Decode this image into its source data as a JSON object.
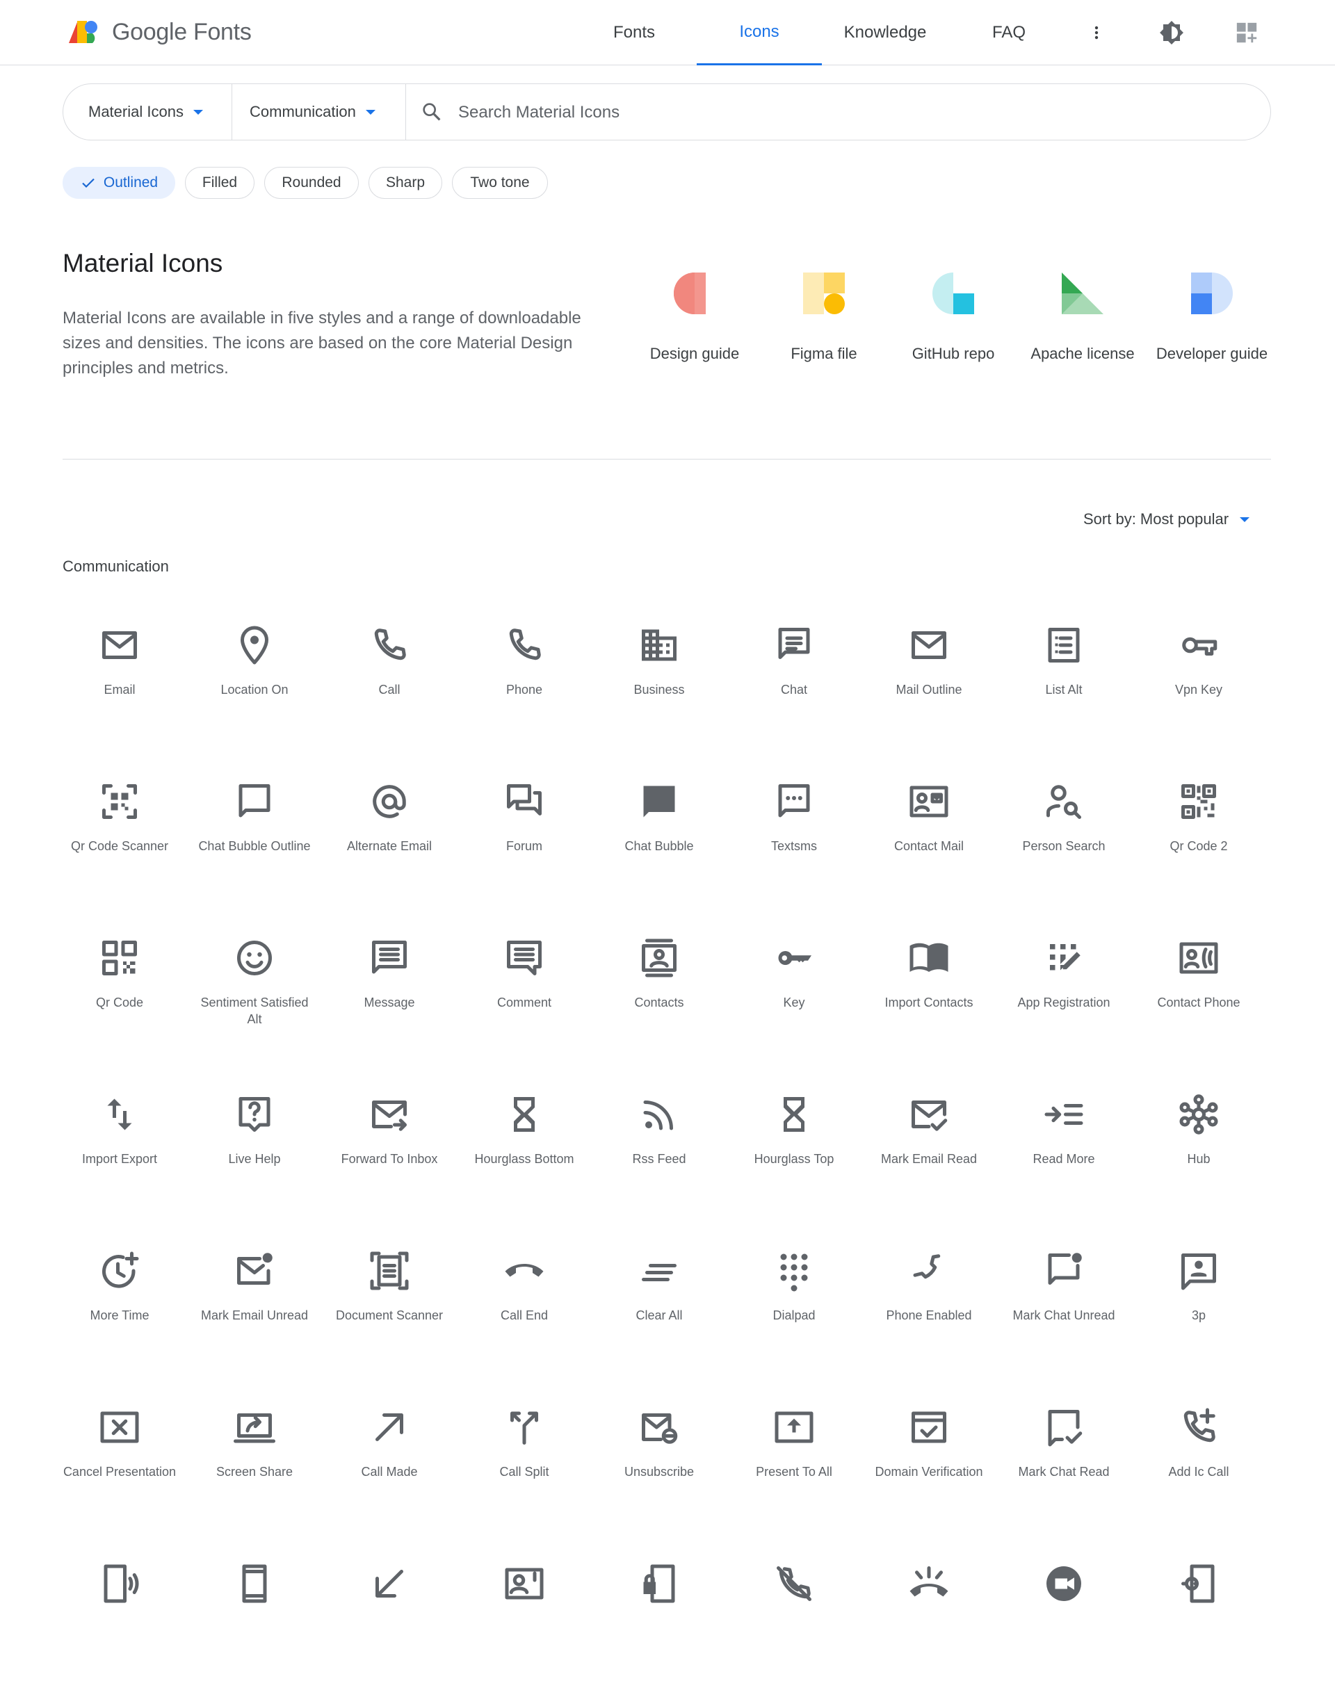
{
  "header": {
    "logo_text": "Google Fonts",
    "nav": [
      "Fonts",
      "Icons",
      "Knowledge",
      "FAQ"
    ],
    "active_nav": "Icons"
  },
  "search": {
    "set_label": "Material Icons",
    "category_label": "Communication",
    "placeholder": "Search Material Icons"
  },
  "styles": [
    "Outlined",
    "Filled",
    "Rounded",
    "Sharp",
    "Two tone"
  ],
  "selected_style": "Outlined",
  "intro": {
    "title": "Material Icons",
    "description": "Material Icons are available in five styles and a range of downloadable sizes and densities. The icons are based on the core Material Design principles and metrics.",
    "resources": [
      "Design guide",
      "Figma file",
      "GitHub repo",
      "Apache license",
      "Developer guide"
    ]
  },
  "sort_label": "Sort by: Most popular",
  "section_title": "Communication",
  "icons": [
    {
      "label": "Email",
      "icon": "email-icon"
    },
    {
      "label": "Location On",
      "icon": "location-on-icon"
    },
    {
      "label": "Call",
      "icon": "call-icon"
    },
    {
      "label": "Phone",
      "icon": "phone-icon"
    },
    {
      "label": "Business",
      "icon": "business-icon"
    },
    {
      "label": "Chat",
      "icon": "chat-icon"
    },
    {
      "label": "Mail Outline",
      "icon": "mail-outline-icon"
    },
    {
      "label": "List Alt",
      "icon": "list-alt-icon"
    },
    {
      "label": "Vpn Key",
      "icon": "vpn-key-icon"
    },
    {
      "label": "Qr Code Scanner",
      "icon": "qr-code-scanner-icon"
    },
    {
      "label": "Chat Bubble Outline",
      "icon": "chat-bubble-outline-icon"
    },
    {
      "label": "Alternate Email",
      "icon": "alternate-email-icon"
    },
    {
      "label": "Forum",
      "icon": "forum-icon"
    },
    {
      "label": "Chat Bubble",
      "icon": "chat-bubble-icon"
    },
    {
      "label": "Textsms",
      "icon": "textsms-icon"
    },
    {
      "label": "Contact Mail",
      "icon": "contact-mail-icon"
    },
    {
      "label": "Person Search",
      "icon": "person-search-icon"
    },
    {
      "label": "Qr Code 2",
      "icon": "qr-code-2-icon"
    },
    {
      "label": "Qr Code",
      "icon": "qr-code-icon"
    },
    {
      "label": "Sentiment Satisfied Alt",
      "icon": "sentiment-satisfied-alt-icon"
    },
    {
      "label": "Message",
      "icon": "message-icon"
    },
    {
      "label": "Comment",
      "icon": "comment-icon"
    },
    {
      "label": "Contacts",
      "icon": "contacts-icon"
    },
    {
      "label": "Key",
      "icon": "key-icon"
    },
    {
      "label": "Import Contacts",
      "icon": "import-contacts-icon"
    },
    {
      "label": "App Registration",
      "icon": "app-registration-icon"
    },
    {
      "label": "Contact Phone",
      "icon": "contact-phone-icon"
    },
    {
      "label": "Import Export",
      "icon": "import-export-icon"
    },
    {
      "label": "Live Help",
      "icon": "live-help-icon"
    },
    {
      "label": "Forward To Inbox",
      "icon": "forward-to-inbox-icon"
    },
    {
      "label": "Hourglass Bottom",
      "icon": "hourglass-bottom-icon"
    },
    {
      "label": "Rss Feed",
      "icon": "rss-feed-icon"
    },
    {
      "label": "Hourglass Top",
      "icon": "hourglass-top-icon"
    },
    {
      "label": "Mark Email Read",
      "icon": "mark-email-read-icon"
    },
    {
      "label": "Read More",
      "icon": "read-more-icon"
    },
    {
      "label": "Hub",
      "icon": "hub-icon"
    },
    {
      "label": "More Time",
      "icon": "more-time-icon"
    },
    {
      "label": "Mark Email Unread",
      "icon": "mark-email-unread-icon"
    },
    {
      "label": "Document Scanner",
      "icon": "document-scanner-icon"
    },
    {
      "label": "Call End",
      "icon": "call-end-icon"
    },
    {
      "label": "Clear All",
      "icon": "clear-all-icon"
    },
    {
      "label": "Dialpad",
      "icon": "dialpad-icon"
    },
    {
      "label": "Phone Enabled",
      "icon": "phone-enabled-icon"
    },
    {
      "label": "Mark Chat Unread",
      "icon": "mark-chat-unread-icon"
    },
    {
      "label": "3p",
      "icon": "3p-icon"
    },
    {
      "label": "Cancel Presentation",
      "icon": "cancel-presentation-icon"
    },
    {
      "label": "Screen Share",
      "icon": "screen-share-icon"
    },
    {
      "label": "Call Made",
      "icon": "call-made-icon"
    },
    {
      "label": "Call Split",
      "icon": "call-split-icon"
    },
    {
      "label": "Unsubscribe",
      "icon": "unsubscribe-icon"
    },
    {
      "label": "Present To All",
      "icon": "present-to-all-icon"
    },
    {
      "label": "Domain Verification",
      "icon": "domain-verification-icon"
    },
    {
      "label": "Mark Chat Read",
      "icon": "mark-chat-read-icon"
    },
    {
      "label": "Add Ic Call",
      "icon": "add-ic-call-icon"
    },
    {
      "label": "",
      "icon": "phonelink-ring-icon"
    },
    {
      "label": "",
      "icon": "stay-current-portrait-icon"
    },
    {
      "label": "",
      "icon": "call-received-icon"
    },
    {
      "label": "",
      "icon": "contact-emergency-icon"
    },
    {
      "label": "",
      "icon": "phonelink-lock-icon"
    },
    {
      "label": "",
      "icon": "phone-disabled-icon"
    },
    {
      "label": "",
      "icon": "ring-volume-icon"
    },
    {
      "label": "",
      "icon": "duo-icon"
    },
    {
      "label": "",
      "icon": "phonelink-setup-icon"
    }
  ]
}
